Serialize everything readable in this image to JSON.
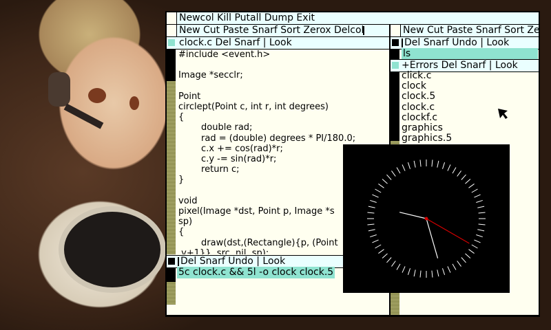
{
  "colors": {
    "tag_bg": "#eaffff",
    "select_bg": "#8fe3d0",
    "body_bg": "#fffff0",
    "scroll": "#99994c",
    "hand_red": "#d40000"
  },
  "row_tag": {
    "label": "Newcol Kill Putall Dump Exit"
  },
  "left_column": {
    "col_tag": "New Cut Paste Snarf Sort Zerox Delcol",
    "file_window": {
      "tag": "clock.c Del Snarf | Look",
      "code_lines": [
        "#include <event.h>",
        "",
        "Image *secclr;",
        "",
        "Point",
        "circlept(Point c, int r, int degrees)",
        "{",
        "        double rad;",
        "        rad = (double) degrees * PI/180.0;",
        "        c.x += cos(rad)*r;",
        "        c.y -= sin(rad)*r;",
        "        return c;",
        "}",
        "",
        "void",
        "pixel(Image *dst, Point p, Image *s",
        "sp)",
        "{",
        "        draw(dst,(Rectangle){p, (Point",
        ".y+1}}, src, nil, sp);"
      ]
    },
    "command_window": {
      "tag": "Del Snarf Undo | Look",
      "body": "5c clock.c && 5l -o clock clock.5"
    }
  },
  "right_column": {
    "col_tag": "New Cut Paste Snarf Sort Zer",
    "top_window": {
      "tag": "Del Snarf Undo | Look",
      "body": "ls"
    },
    "errors_window": {
      "tag": "+Errors Del Snarf | Look",
      "files": [
        "click.c",
        "clock",
        "clock.5",
        "clock.c",
        "clockf.c",
        "graphics",
        "graphics.5"
      ]
    }
  },
  "clock": {
    "hour": 9,
    "minute": 27,
    "second": 20
  }
}
